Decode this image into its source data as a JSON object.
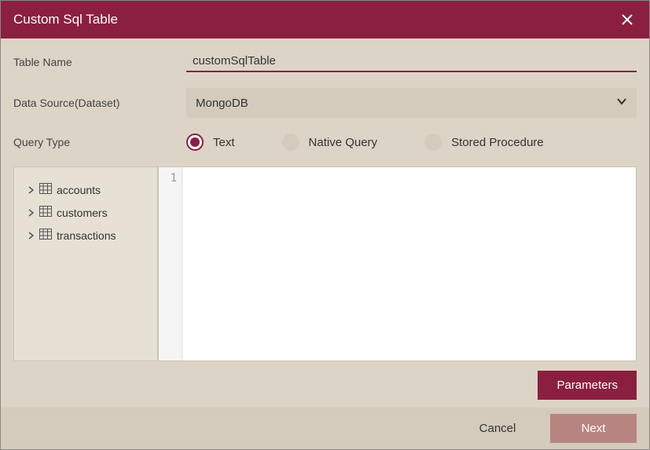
{
  "titlebar": {
    "title": "Custom Sql Table"
  },
  "form": {
    "tableName": {
      "label": "Table Name",
      "value": "customSqlTable"
    },
    "dataSource": {
      "label": "Data Source(Dataset)",
      "value": "MongoDB"
    },
    "queryType": {
      "label": "Query Type",
      "options": [
        {
          "label": "Text",
          "selected": true
        },
        {
          "label": "Native Query",
          "selected": false
        },
        {
          "label": "Stored Procedure",
          "selected": false
        }
      ]
    }
  },
  "tree": {
    "items": [
      {
        "label": "accounts"
      },
      {
        "label": "customers"
      },
      {
        "label": "transactions"
      }
    ]
  },
  "editor": {
    "lineNumber": "1",
    "content": ""
  },
  "buttons": {
    "parameters": "Parameters",
    "cancel": "Cancel",
    "next": "Next"
  }
}
